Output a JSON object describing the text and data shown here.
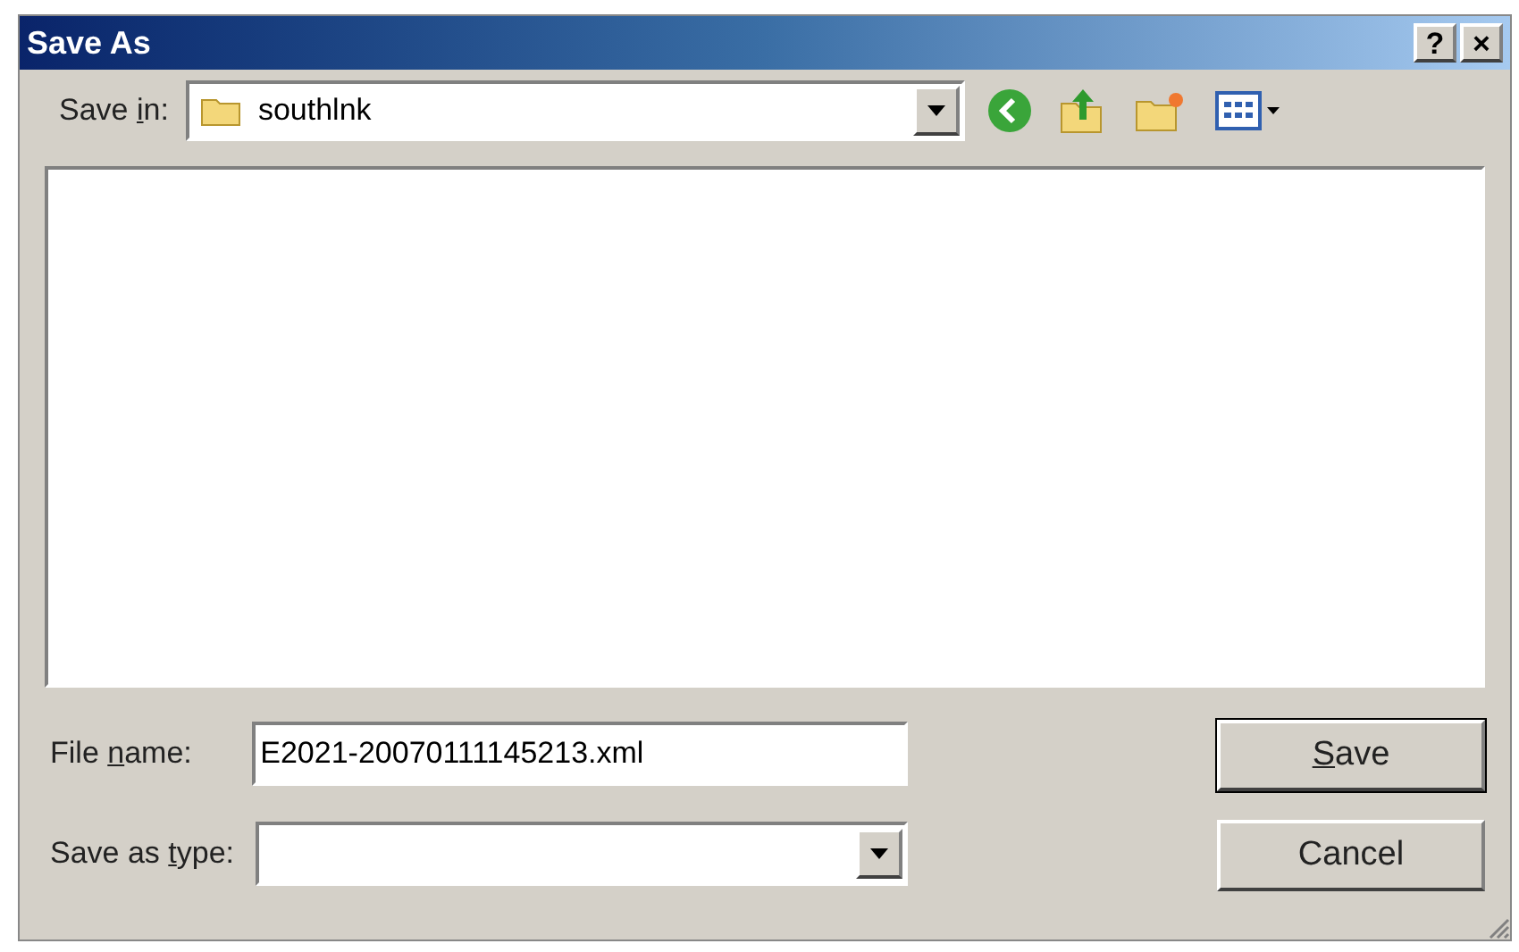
{
  "window": {
    "title": "Save As",
    "buttons": [
      "?",
      "×"
    ]
  },
  "save_in": {
    "label_parts": [
      {
        "text": "Save ",
        "underlined": false
      },
      {
        "text": "i",
        "underlined": true
      },
      {
        "text": "n:",
        "underlined": false
      }
    ],
    "value": "southlnk"
  },
  "file_name": {
    "label_parts": [
      {
        "text": "File ",
        "underlined": false
      },
      {
        "text": "n",
        "underlined": true
      },
      {
        "text": "ame:",
        "underlined": false
      }
    ],
    "value": "E2021-20070111145213.xml"
  },
  "save_as_type": {
    "label_parts": [
      {
        "text": "Save as ",
        "underlined": false
      },
      {
        "text": "t",
        "underlined": true
      },
      {
        "text": "ype:",
        "underlined": false
      }
    ]
  },
  "buttons": [
    {
      "label_parts": [
        {
          "text": "S",
          "underlined": true
        },
        {
          "text": "ave",
          "underlined": false
        }
      ],
      "default": true
    },
    {
      "label_parts": [
        {
          "text": "Cancel",
          "underlined": false
        }
      ],
      "default": false
    }
  ]
}
